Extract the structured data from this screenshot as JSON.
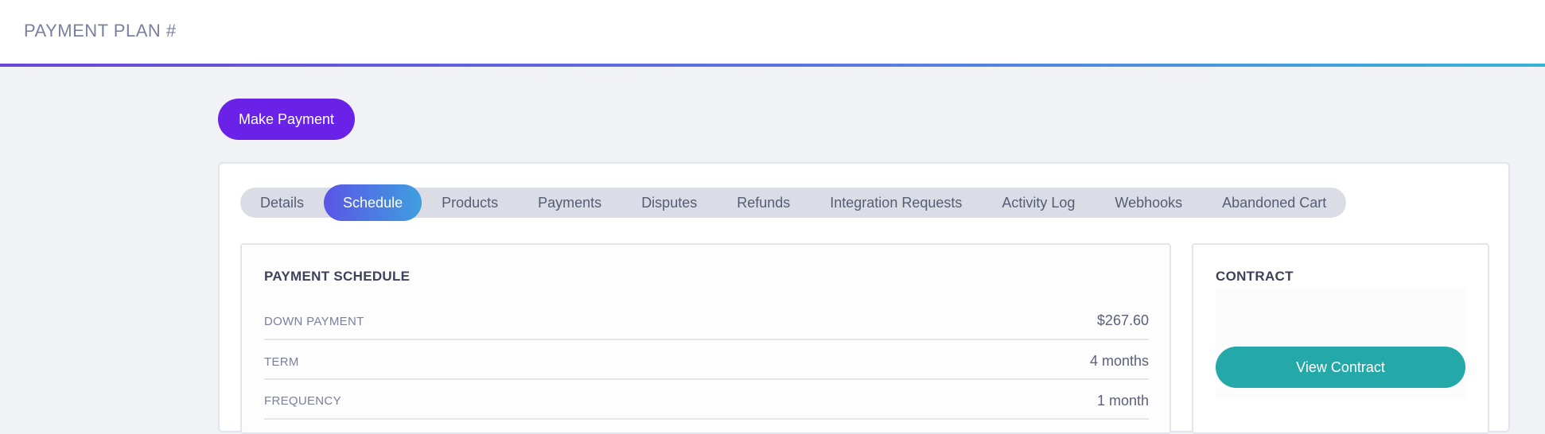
{
  "header": {
    "title": "PAYMENT PLAN #"
  },
  "actions": {
    "make_payment_label": "Make Payment"
  },
  "tabs": [
    {
      "label": "Details",
      "active": false
    },
    {
      "label": "Schedule",
      "active": true
    },
    {
      "label": "Products",
      "active": false
    },
    {
      "label": "Payments",
      "active": false
    },
    {
      "label": "Disputes",
      "active": false
    },
    {
      "label": "Refunds",
      "active": false
    },
    {
      "label": "Integration Requests",
      "active": false
    },
    {
      "label": "Activity Log",
      "active": false
    },
    {
      "label": "Webhooks",
      "active": false
    },
    {
      "label": "Abandoned Cart",
      "active": false
    }
  ],
  "schedule": {
    "heading": "PAYMENT SCHEDULE",
    "rows": [
      {
        "label": "DOWN PAYMENT",
        "value": "$267.60"
      },
      {
        "label": "TERM",
        "value": "4 months"
      },
      {
        "label": "FREQUENCY",
        "value": "1 month"
      }
    ]
  },
  "contract": {
    "heading": "CONTRACT",
    "button_label": "View Contract"
  },
  "colors": {
    "primary_button": "#6a22e8",
    "contract_button": "#24a9a8",
    "active_tab_start": "#5a55e6",
    "active_tab_end": "#3f9fe0"
  }
}
